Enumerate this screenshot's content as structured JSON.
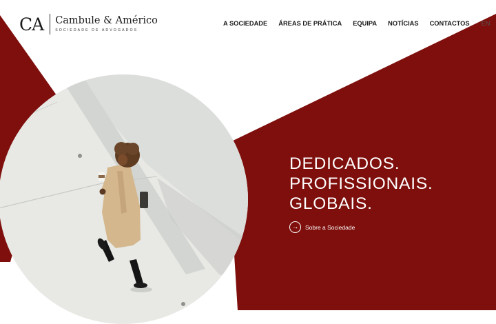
{
  "brand": {
    "mark": "CA",
    "name": "Cambule & Américo",
    "subtitle": "SOCIEDADE DE ADVOGADOS"
  },
  "nav": {
    "items": [
      {
        "label": "A SOCIEDADE"
      },
      {
        "label": "ÁREAS DE PRÁTICA"
      },
      {
        "label": "EQUIPA"
      },
      {
        "label": "NOTÍCIAS"
      },
      {
        "label": "CONTACTOS"
      }
    ],
    "language": "EN"
  },
  "hero": {
    "headline": [
      "DEDICADOS.",
      "PROFISSIONAIS.",
      "GLOBAIS."
    ],
    "cta_label": "Sobre a Sociedade",
    "cta_icon": "arrow-right-icon",
    "photo": "woman-in-beige-trench-coat-walking-with-coffee-cup"
  },
  "colors": {
    "accent": "#7e0f0c",
    "text_dark": "#1a1a1a",
    "background": "#ffffff"
  }
}
